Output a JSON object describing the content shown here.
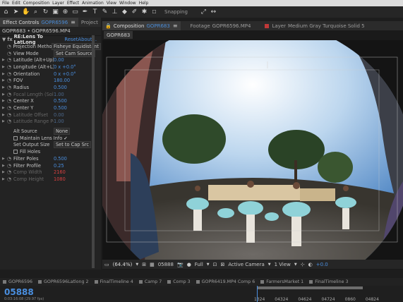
{
  "menubar": {
    "items": [
      "File",
      "Edit",
      "Composition",
      "Layer",
      "Effect",
      "Animation",
      "View",
      "Window",
      "Help"
    ]
  },
  "toolbar": {
    "snapping_label": "Snapping"
  },
  "effect_panel": {
    "tabs": [
      {
        "label": "Effect Controls",
        "blue": "GOPR6596",
        "active": true
      },
      {
        "label": "Project",
        "active": false
      }
    ],
    "subtitle": "GOPR683 • GOPR6596.MP4",
    "effect_name": "RE:Lens To LatLong",
    "reset_label": "Reset",
    "about_label": "About...",
    "properties": [
      {
        "name": "Projection Method",
        "value": "Fisheye Equidistant",
        "kind": "dropdown"
      },
      {
        "name": "View Mode",
        "value": "Set Cam Source",
        "kind": "dropdown"
      },
      {
        "name": "Latitude (Alt+Up)",
        "value": "0.00",
        "kind": "value"
      },
      {
        "name": "Longitude (Alt+L)",
        "value": "0 x +0.0°",
        "kind": "value"
      },
      {
        "name": "Orientation",
        "value": "0 x +0.0°",
        "kind": "value"
      },
      {
        "name": "FOV",
        "value": "180.00",
        "kind": "value"
      },
      {
        "name": "Radius",
        "value": "0.500",
        "kind": "value"
      },
      {
        "name": "Focal Length (Sold)",
        "value": "1.00",
        "kind": "dim"
      },
      {
        "name": "Center X",
        "value": "0.500",
        "kind": "value"
      },
      {
        "name": "Center Y",
        "value": "0.500",
        "kind": "value"
      },
      {
        "name": "Latitude Offset",
        "value": "0.00",
        "kind": "dim"
      },
      {
        "name": "Latitude Range Pct",
        "value": "1.00",
        "kind": "dim"
      }
    ],
    "alt_source_label": "Alt Source",
    "alt_source_value": "None",
    "maintain_label": "Maintain Lens Info",
    "output_size_label": "Set Output Size",
    "output_size_value": "Set to Cap Src",
    "fill_holes_label": "Fill Holes",
    "extra_props": [
      {
        "name": "Filter Poles",
        "value": "0.500",
        "kind": "value"
      },
      {
        "name": "Filter Profile",
        "value": "0.25",
        "kind": "value"
      },
      {
        "name": "Comp Width",
        "value": "2160",
        "kind": "red"
      },
      {
        "name": "Comp Height",
        "value": "1080",
        "kind": "red"
      }
    ]
  },
  "comp_panel": {
    "tabs": [
      {
        "label": "Composition",
        "blue": "GOPR683",
        "active": true
      },
      {
        "label": "Footage",
        "blue": "GOPR6596.MP4",
        "active": false
      },
      {
        "label": "Layer",
        "blue": "Medium Gray Turquoise Solid 5",
        "active": false
      }
    ],
    "subtab": "GOPR683",
    "footer": {
      "zoom": "(64.4%)",
      "timecode": "05888",
      "resolution": "Full",
      "camera": "Active Camera",
      "view": "1 View",
      "exposure": "+0.0"
    }
  },
  "timeline": {
    "tabs": [
      "GOPR6596",
      "GOPR6596Latlong 2",
      "FinalTimeline 4",
      "Camp 7",
      "Comp 3",
      "GOPR6419.MP4 Comp 6",
      "FarmersMarket 1",
      "FinalTimeline 3"
    ],
    "timecode": "05888",
    "timecode_sub": "0:03:16:08 (29.97 fps)",
    "ruler": [
      "1324",
      "04324",
      "04624",
      "04724",
      "0860",
      "04824"
    ]
  },
  "colors": {
    "accent": "#4a8fe0",
    "warning": "#d84040"
  }
}
